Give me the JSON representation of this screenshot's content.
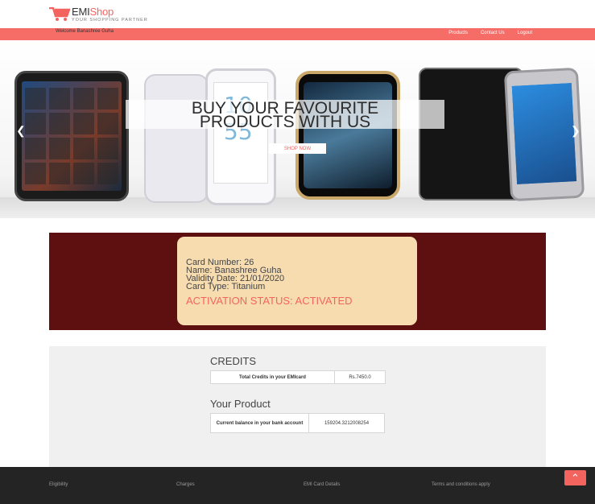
{
  "header": {
    "brand_emi": "EMI",
    "brand_shop": "Shop",
    "tagline": "YOUR SHOPPING PARTNER",
    "welcome": "Welcome Banashree Guha",
    "nav": [
      "Products",
      "Contact Us",
      "Logout"
    ]
  },
  "hero": {
    "banner_line1": "BUY YOUR FAVOURITE",
    "banner_line2": "PRODUCTS WITH US",
    "button": "SHOP NOW",
    "prev_icon": "chevron-left-icon",
    "next_icon": "chevron-right-icon"
  },
  "card": {
    "number": "Card Number: 26",
    "name": "Name: Banashree Guha",
    "validity": "Validity Date: 21/01/2020",
    "type": "Card Type: Titanium",
    "status": "ACTIVATION STATUS: ACTIVATED"
  },
  "credits": {
    "heading": "CREDITS",
    "label": "Total Credits in your EMIcard",
    "value": "Rs.7450.0"
  },
  "product": {
    "heading": "Your Product",
    "label": "Current balance in your bank account",
    "value": "159204.3212008254"
  },
  "footer": {
    "links": [
      "Eligibility",
      "Charges",
      "EMI Card Details",
      "Terms and conditions apply"
    ]
  },
  "colors": {
    "accent": "#f66c66",
    "card_bg": "#f7dcb0",
    "section_bg": "#5e1010",
    "footer_bg": "#242424"
  }
}
